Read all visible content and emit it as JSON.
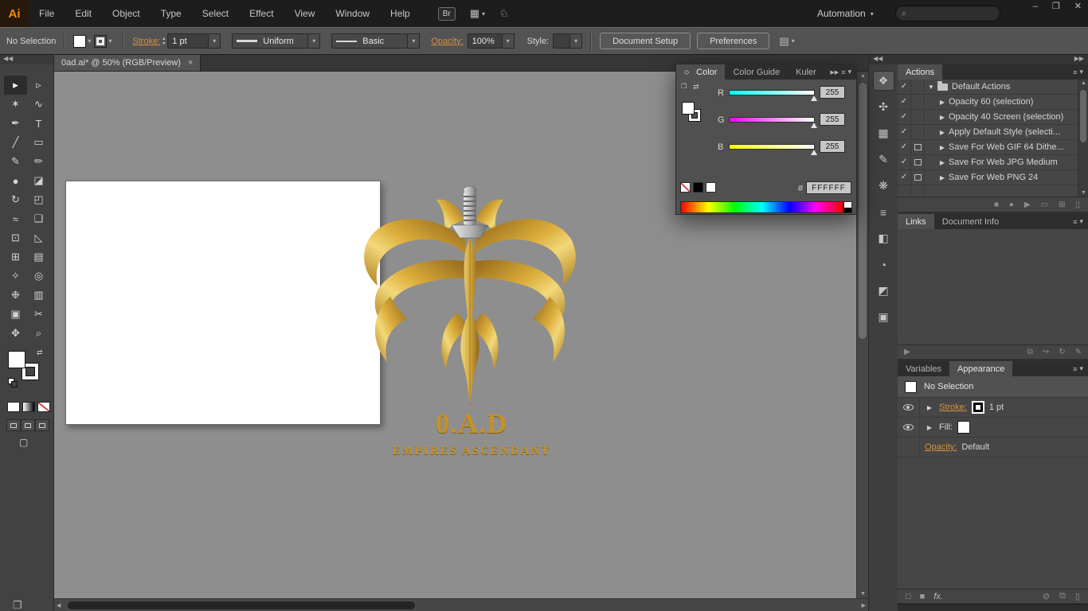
{
  "window": {
    "minimize": "–",
    "restore": "❐",
    "close": "✕"
  },
  "menubar": {
    "logo": "Ai",
    "items": [
      "File",
      "Edit",
      "Object",
      "Type",
      "Select",
      "Effect",
      "View",
      "Window",
      "Help"
    ],
    "bridge_label": "Br",
    "workspace": "Automation"
  },
  "controlbar": {
    "selection_status": "No Selection",
    "stroke_label": "Stroke:",
    "stroke_value": "1 pt",
    "width_profile": "Uniform",
    "brush_style": "Basic",
    "opacity_label": "Opacity:",
    "opacity_value": "100%",
    "style_label": "Style:",
    "document_setup_label": "Document Setup",
    "preferences_label": "Preferences"
  },
  "document_tab": {
    "title": "0ad.ai* @ 50% (RGB/Preview)"
  },
  "canvas_logo": {
    "title": "0.A.D",
    "subtitle": "EMPIRES ASCENDANT"
  },
  "color_panel": {
    "tabs": [
      "Color",
      "Color Guide",
      "Kuler"
    ],
    "channels": [
      {
        "label": "R",
        "value": "255",
        "gradient_from": "#00ffff",
        "gradient_to": "#ffffff"
      },
      {
        "label": "G",
        "value": "255",
        "gradient_from": "#ff00ff",
        "gradient_to": "#ffffff"
      },
      {
        "label": "B",
        "value": "255",
        "gradient_from": "#ffff00",
        "gradient_to": "#ffffff"
      }
    ],
    "hex_prefix": "#",
    "hex_value": "FFFFFF"
  },
  "actions_panel": {
    "title": "Actions",
    "items": [
      {
        "check": "✓",
        "expander": "▼",
        "label": "Default Actions"
      },
      {
        "check": "✓",
        "expander": "▶",
        "label": "Opacity 60 (selection)"
      },
      {
        "check": "✓",
        "expander": "▶",
        "label": "Opacity 40 Screen (selection)"
      },
      {
        "check": "✓",
        "expander": "▶",
        "label": "Apply Default Style (selecti..."
      },
      {
        "check": "✓",
        "expander": "▶",
        "label": "Save For Web GIF 64 Dithe..."
      },
      {
        "check": "✓",
        "expander": "▶",
        "label": "Save For Web JPG Medium"
      },
      {
        "check": "✓",
        "expander": "▶",
        "label": "Save For Web PNG 24"
      }
    ]
  },
  "links_panel": {
    "tabs": [
      "Links",
      "Document Info"
    ]
  },
  "appearance_panel": {
    "tabs": [
      "Variables",
      "Appearance"
    ],
    "selection_status": "No Selection",
    "stroke_label": "Stroke:",
    "stroke_value": "1 pt",
    "fill_label": "Fill:",
    "opacity_label": "Opacity:",
    "opacity_value": "Default",
    "fx_label": "fx."
  },
  "tools": [
    {
      "name": "selection",
      "glyph": "▸"
    },
    {
      "name": "direct-selection",
      "glyph": "▹"
    },
    {
      "name": "magic-wand",
      "glyph": "✶"
    },
    {
      "name": "lasso",
      "glyph": "∿"
    },
    {
      "name": "pen",
      "glyph": "✒"
    },
    {
      "name": "type",
      "glyph": "T"
    },
    {
      "name": "line-segment",
      "glyph": "╱"
    },
    {
      "name": "rectangle",
      "glyph": "▭"
    },
    {
      "name": "paintbrush",
      "glyph": "✎"
    },
    {
      "name": "pencil",
      "glyph": "✏"
    },
    {
      "name": "blob-brush",
      "glyph": "●"
    },
    {
      "name": "eraser",
      "glyph": "◪"
    },
    {
      "name": "rotate",
      "glyph": "↻"
    },
    {
      "name": "scale",
      "glyph": "◰"
    },
    {
      "name": "width",
      "glyph": "≈"
    },
    {
      "name": "free-transform",
      "glyph": "❏"
    },
    {
      "name": "shape-builder",
      "glyph": "⊡"
    },
    {
      "name": "perspective-grid",
      "glyph": "◺"
    },
    {
      "name": "mesh",
      "glyph": "⊞"
    },
    {
      "name": "gradient",
      "glyph": "▤"
    },
    {
      "name": "eyedropper",
      "glyph": "✧"
    },
    {
      "name": "blend",
      "glyph": "◎"
    },
    {
      "name": "symbol-sprayer",
      "glyph": "❉"
    },
    {
      "name": "column-graph",
      "glyph": "▥"
    },
    {
      "name": "artboard",
      "glyph": "▣"
    },
    {
      "name": "slice",
      "glyph": "✂"
    },
    {
      "name": "hand",
      "glyph": "✥"
    },
    {
      "name": "zoom",
      "glyph": "⌕"
    }
  ],
  "dock_icons": [
    {
      "name": "color",
      "glyph": "❖"
    },
    {
      "name": "color-guide",
      "glyph": "✣"
    },
    {
      "name": "swatches",
      "glyph": "▦"
    },
    {
      "name": "brushes",
      "glyph": "✎"
    },
    {
      "name": "symbols",
      "glyph": "❋"
    },
    {
      "name": "stroke",
      "glyph": "≡"
    },
    {
      "name": "gradient",
      "glyph": "◧"
    },
    {
      "name": "transparency",
      "glyph": "◔"
    },
    {
      "name": "appearance",
      "glyph": "◩"
    },
    {
      "name": "graphic-styles",
      "glyph": "▣"
    }
  ],
  "icons": {
    "dropdown": "▾",
    "search": "⌕",
    "collapse_left": "◀◀",
    "collapse_right": "▶▶",
    "panel_menu": "≡",
    "panel_badge": "◇",
    "close_tab": "×",
    "swap": "⇄",
    "stepper_up": "▴",
    "stepper_down": "▾",
    "align": "▤",
    "arrange": "▦",
    "touch": "♘",
    "stop": "■",
    "record": "●",
    "play": "▶",
    "new_set": "▭",
    "new_action": "⊞",
    "trash": "▯",
    "link_info": "▶",
    "relink": "⧉",
    "goto_link": "↪",
    "update_link": "↻",
    "edit_original": "✎",
    "add_stroke": "□",
    "add_fill": "■",
    "clear_appearance": "⊘",
    "duplicate": "⧉",
    "up": "▲",
    "down": "▼",
    "left": "◀",
    "right": "▶",
    "screen_mode": "▢",
    "windows": "❐"
  }
}
